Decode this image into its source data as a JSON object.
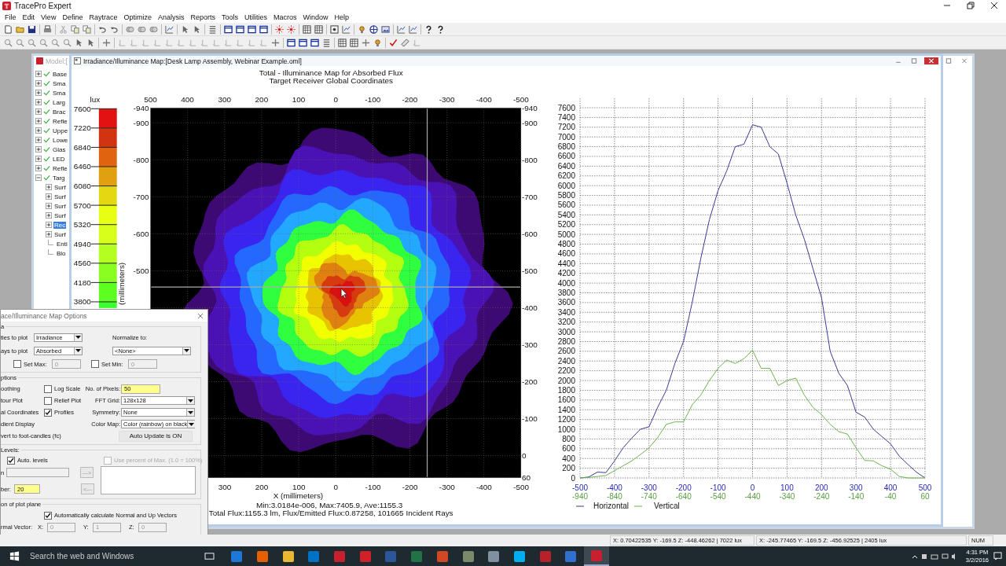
{
  "app": {
    "title": "TracePro Expert"
  },
  "menu": [
    "File",
    "Edit",
    "View",
    "Define",
    "Raytrace",
    "Optimize",
    "Analysis",
    "Reports",
    "Tools",
    "Utilities",
    "Macros",
    "Window",
    "Help"
  ],
  "model_window": {
    "title": "Model:[",
    "tree": [
      {
        "label": "Base",
        "checked": true,
        "expanded": false
      },
      {
        "label": "Sma",
        "checked": true,
        "expanded": false
      },
      {
        "label": "Sma",
        "checked": true,
        "expanded": false
      },
      {
        "label": "Larg",
        "checked": true,
        "expanded": false
      },
      {
        "label": "Brac",
        "checked": true,
        "expanded": false
      },
      {
        "label": "Refle",
        "checked": true,
        "expanded": false
      },
      {
        "label": "Uppe",
        "checked": true,
        "expanded": false
      },
      {
        "label": "Lowe",
        "checked": true,
        "expanded": false
      },
      {
        "label": "Glas",
        "checked": true,
        "expanded": false
      },
      {
        "label": "LED",
        "checked": true,
        "expanded": false
      },
      {
        "label": "Refle",
        "checked": true,
        "expanded": false
      },
      {
        "label": "Targ",
        "checked": true,
        "expanded": true,
        "children": [
          {
            "label": "Surf",
            "kind": "node",
            "selected": false
          },
          {
            "label": "Surf",
            "kind": "node",
            "selected": false
          },
          {
            "label": "Surf",
            "kind": "node",
            "selected": false
          },
          {
            "label": "Surf",
            "kind": "node",
            "selected": false
          },
          {
            "label": "Rec",
            "kind": "node",
            "selected": true
          },
          {
            "label": "Surf",
            "kind": "node",
            "selected": false
          },
          {
            "label": "Enti",
            "kind": "leaf",
            "selected": false
          },
          {
            "label": "Blo",
            "kind": "leaf",
            "selected": false
          }
        ]
      }
    ]
  },
  "map_window": {
    "title": "Irradiance/Illuminance Map:[Desk Lamp Assembly, Webinar Example.oml]",
    "plot_title": [
      "Total - Illuminance Map for Absorbed Flux",
      "Target Receiver   Global Coordinates"
    ],
    "colorbar": {
      "unit": "lux",
      "levels": [
        {
          "label": "7600",
          "color": "#e01212"
        },
        {
          "label": "7220",
          "color": "#d23412"
        },
        {
          "label": "6840",
          "color": "#e06410"
        },
        {
          "label": "6460",
          "color": "#e0a010"
        },
        {
          "label": "6080",
          "color": "#e4d812"
        },
        {
          "label": "5700",
          "color": "#e8ff14"
        },
        {
          "label": "5320",
          "color": "#d8ff1c"
        },
        {
          "label": "4940",
          "color": "#b4ff20"
        },
        {
          "label": "4560",
          "color": "#88ff20"
        },
        {
          "label": "4180",
          "color": "#5cff20"
        },
        {
          "label": "3800",
          "color": "#40ff30"
        }
      ]
    },
    "map": {
      "x_top_ticks": [
        "500",
        "400",
        "300",
        "200",
        "100",
        "0",
        "-100",
        "-200",
        "-300",
        "-400",
        "-500"
      ],
      "y_left_ticks": [
        "-940",
        "-900",
        "-800",
        "-700",
        "-600",
        "-500"
      ],
      "y_right_ticks": [
        "-940",
        "-900",
        "-800",
        "-700",
        "-600",
        "-500",
        "-400",
        "-300",
        "-200",
        "-100",
        "0",
        "60"
      ],
      "x_bottom_ticks": [
        "300",
        "200",
        "100",
        "0",
        "-100",
        "-200",
        "-300",
        "-400",
        "-500"
      ],
      "y_axis_label": "(millimeters)",
      "x_axis_label": "X (millimeters)"
    },
    "stats": "Min:3.0184e-006, Max:7405.9, Ave:1155.3",
    "flux": "Total Flux:1155.3 lm, Flux/Emitted Flux:0.87258, 101665 Incident Rays",
    "profile": {
      "chart_data": {
        "type": "line",
        "x": [
          -500,
          -475,
          -450,
          -425,
          -400,
          -375,
          -350,
          -325,
          -300,
          -275,
          -250,
          -225,
          -200,
          -175,
          -150,
          -125,
          -100,
          -75,
          -50,
          -25,
          0,
          25,
          50,
          75,
          100,
          125,
          150,
          175,
          200,
          225,
          250,
          275,
          300,
          325,
          350,
          375,
          400,
          425,
          450,
          475,
          500
        ],
        "series": [
          {
            "name": "Horizontal",
            "color": "#3a3a96",
            "values": [
              0,
              20,
              120,
              110,
              350,
              620,
              820,
              1000,
              1050,
              1450,
              1800,
              2350,
              2800,
              3600,
              4500,
              5300,
              5900,
              6300,
              6800,
              6850,
              7250,
              7200,
              6800,
              6650,
              6050,
              5400,
              4900,
              4300,
              3700,
              2600,
              2150,
              1900,
              1350,
              1250,
              1000,
              850,
              700,
              450,
              280,
              120,
              0
            ]
          },
          {
            "name": "Vertical",
            "color": "#6cb44c",
            "values": [
              0,
              10,
              30,
              50,
              150,
              250,
              350,
              480,
              620,
              830,
              1100,
              1150,
              1150,
              1500,
              1700,
              2000,
              2250,
              2420,
              2350,
              2450,
              2620,
              2250,
              2250,
              1900,
              2000,
              2050,
              1700,
              1450,
              1300,
              1100,
              950,
              900,
              620,
              360,
              350,
              250,
              180,
              30,
              0,
              0,
              0
            ]
          }
        ],
        "xlim": [
          -500,
          500
        ],
        "ylim": [
          0,
          7600
        ],
        "grid": true,
        "legend": true,
        "xticks": [
          {
            "value": -500,
            "label": "-500"
          },
          {
            "value": -400,
            "label": "-400"
          },
          {
            "value": -300,
            "label": "-300"
          },
          {
            "value": -200,
            "label": "-200"
          },
          {
            "value": -100,
            "label": "-100"
          },
          {
            "value": 0,
            "label": "0"
          },
          {
            "value": 100,
            "label": "100"
          },
          {
            "value": 200,
            "label": "200"
          },
          {
            "value": 300,
            "label": "300"
          },
          {
            "value": 400,
            "label": "400"
          },
          {
            "value": 500,
            "label": "500"
          }
        ],
        "yticks": [
          {
            "value": 0,
            "label": "0"
          },
          {
            "value": 200,
            "label": "200"
          },
          {
            "value": 400,
            "label": "400"
          },
          {
            "value": 600,
            "label": "600"
          },
          {
            "value": 800,
            "label": "800"
          },
          {
            "value": 1000,
            "label": "1000"
          },
          {
            "value": 1200,
            "label": "1200"
          },
          {
            "value": 1400,
            "label": "1400"
          },
          {
            "value": 1600,
            "label": "1600"
          },
          {
            "value": 1800,
            "label": "1800"
          },
          {
            "value": 2000,
            "label": "2000"
          },
          {
            "value": 2200,
            "label": "2200"
          },
          {
            "value": 2400,
            "label": "2400"
          },
          {
            "value": 2600,
            "label": "2600"
          },
          {
            "value": 2800,
            "label": "2800"
          },
          {
            "value": 3000,
            "label": "3000"
          },
          {
            "value": 3200,
            "label": "3200"
          },
          {
            "value": 3400,
            "label": "3400"
          },
          {
            "value": 3600,
            "label": "3600"
          },
          {
            "value": 3800,
            "label": "3800"
          },
          {
            "value": 4000,
            "label": "4000"
          },
          {
            "value": 4200,
            "label": "4200"
          },
          {
            "value": 4400,
            "label": "4400"
          },
          {
            "value": 4600,
            "label": "4600"
          },
          {
            "value": 4800,
            "label": "4800"
          },
          {
            "value": 5000,
            "label": "5000"
          },
          {
            "value": 5200,
            "label": "5200"
          },
          {
            "value": 5400,
            "label": "5400"
          },
          {
            "value": 5600,
            "label": "5600"
          },
          {
            "value": 5800,
            "label": "5800"
          },
          {
            "value": 6000,
            "label": "6000"
          },
          {
            "value": 6200,
            "label": "6200"
          },
          {
            "value": 6400,
            "label": "6400"
          },
          {
            "value": 6600,
            "label": "6600"
          },
          {
            "value": 6800,
            "label": "6800"
          },
          {
            "value": 7000,
            "label": "7000"
          },
          {
            "value": 7200,
            "label": "7200"
          },
          {
            "value": 7400,
            "label": "7400"
          },
          {
            "value": 7600,
            "label": "7600"
          }
        ]
      },
      "vertical_axis_labels": [
        "-940",
        "-840",
        "-740",
        "-640",
        "-540",
        "-440",
        "-340",
        "-240",
        "-140",
        "-40",
        "60"
      ]
    }
  },
  "options_dialog": {
    "title": "ace/Illuminance Map Options",
    "data_group": {
      "label": "a",
      "quantity": {
        "label": "ties to plot",
        "value": "Irradiance"
      },
      "rays": {
        "label": "ays to plot",
        "value": "Absorbed"
      },
      "normalize": {
        "label": "Normalize to:",
        "value": "<None>"
      },
      "set_max": {
        "label": "Set Max:",
        "checked": false,
        "value": "0",
        "disabled": true
      },
      "set_min": {
        "label": "Set Min:",
        "checked": false,
        "value": "0",
        "disabled": true
      }
    },
    "options_group": {
      "label": "ptions",
      "left_items": [
        "oothing",
        "tour Plot",
        "al Coordinates",
        "dient Display",
        "vert to foot-candles (fc)"
      ],
      "checkboxes": [
        {
          "label": "Log Scale",
          "checked": false
        },
        {
          "label": "Relief Plot",
          "checked": false
        },
        {
          "label": "Profiles",
          "checked": true
        }
      ],
      "fields": [
        {
          "label": "No. of Pixels:",
          "value": "50",
          "kind": "input",
          "highlighted": true
        },
        {
          "label": "FFT Grid:",
          "value": "128x128",
          "kind": "select",
          "highlighted": false
        },
        {
          "label": "Symmetry:",
          "value": "None",
          "kind": "select",
          "highlighted": false
        },
        {
          "label": "Color Map:",
          "value": "Color (rainbow) on black",
          "kind": "select",
          "highlighted": false
        }
      ],
      "auto_update_button": "Auto Update is ON"
    },
    "levels_group": {
      "label": "Levels:",
      "auto_levels": {
        "label": "Auto. levels",
        "checked": true
      },
      "use_percent": {
        "label": "Use percent of Max. (1.0 = 100%)",
        "checked": false,
        "disabled": true
      },
      "level_label": "n",
      "add_button": "--->",
      "remove_button": "<---",
      "number": {
        "label": "ber:",
        "value": "20",
        "highlighted": true
      }
    },
    "plane_group": {
      "label": "on of plot plane",
      "auto_vectors": {
        "label": "Automatically calculate Normal and Up Vectors",
        "checked": true
      },
      "normal_vector": {
        "label": "rmal Vector:",
        "components": [
          {
            "label": "X:",
            "value": "0",
            "disabled": true
          },
          {
            "label": "Y:",
            "value": "1",
            "disabled": true
          },
          {
            "label": "Z:",
            "value": "0",
            "disabled": true
          }
        ]
      }
    }
  },
  "status_bar": [
    "X: 0.70422535 Y: -169.5 Z: -448.46262 | 7022 lux",
    "X: -245.77465 Y: -169.5 Z: -456.92525 | 2405 lux",
    "NUM"
  ],
  "taskbar": {
    "search_placeholder": "Search the web and Windows",
    "apps": [
      {
        "color": "#1e78d7",
        "selected": false
      },
      {
        "color": "#e66000",
        "selected": false
      },
      {
        "color": "#e8b830",
        "selected": false
      },
      {
        "color": "#0072c6",
        "selected": false
      },
      {
        "color": "#c8202f",
        "selected": false
      },
      {
        "color": "#d0202a",
        "selected": false
      },
      {
        "color": "#2b579a",
        "selected": false
      },
      {
        "color": "#217346",
        "selected": false
      },
      {
        "color": "#d24726",
        "selected": false
      },
      {
        "color": "#7a8a6a",
        "selected": false
      },
      {
        "color": "#8090a0",
        "selected": false
      },
      {
        "color": "#00aff0",
        "selected": false
      },
      {
        "color": "#b8202a",
        "selected": false
      },
      {
        "color": "#3070d0",
        "selected": false
      },
      {
        "color": "#c8202f",
        "selected": true
      }
    ],
    "time": "4:31 PM",
    "date": "3/2/2016"
  }
}
